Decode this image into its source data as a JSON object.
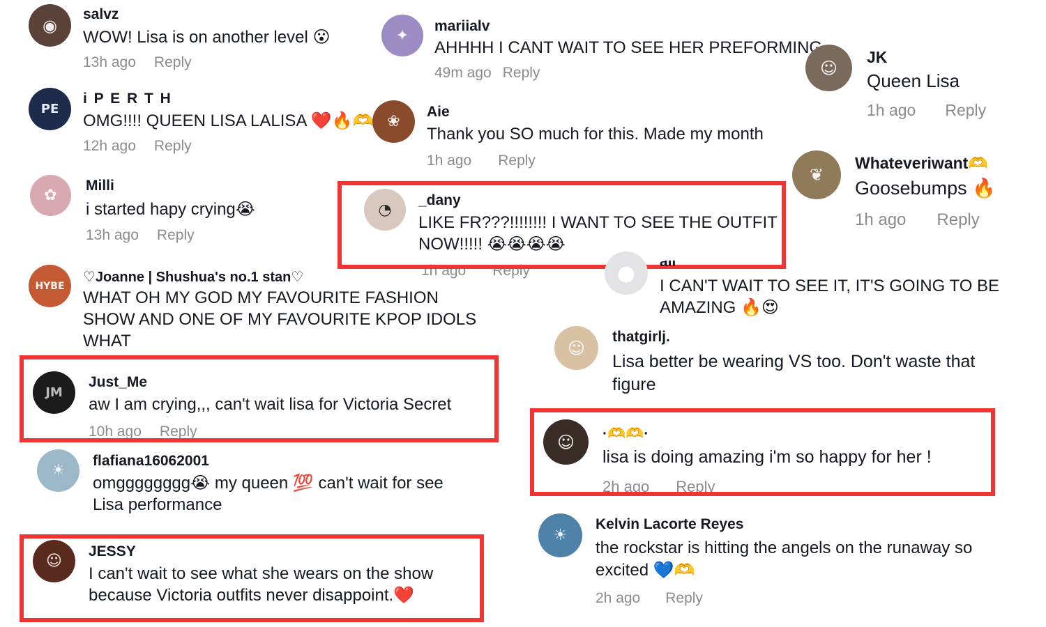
{
  "comments": {
    "salvz": {
      "user": "salvz",
      "text": "WOW! Lisa is on another level 😮",
      "time": "13h ago",
      "reply": "Reply",
      "avatar_color": "#5a4238"
    },
    "iperth": {
      "user": "i P E R T H",
      "text": "OMG!!!! QUEEN LISA LALISA ❤️🔥🫶",
      "time": "12h ago",
      "reply": "Reply",
      "avatar_color": "#1f2b4a"
    },
    "milli": {
      "user": "Milli",
      "text": "i started hapy crying😭",
      "time": "13h ago",
      "reply": "Reply",
      "avatar_color": "#d9a9b2"
    },
    "joanne": {
      "user": "♡Joanne | Shushua's no.1 stan♡",
      "text_lines": [
        "WHAT OH MY GOD MY FAVOURITE FASHION",
        "SHOW AND ONE OF MY FAVOURITE KPOP IDOLS",
        "WHAT"
      ],
      "avatar_color": "#c45a32"
    },
    "justme": {
      "user": "Just_Me",
      "text": "aw I am crying,,, can't wait lisa for Victoria Secret",
      "time": "10h ago",
      "reply": "Reply",
      "avatar_color": "#1b1b1b"
    },
    "flafiana": {
      "user": "flafiana16062001",
      "text_lines": [
        "omgggggggg😭 my queen 💯 can't wait for see",
        "Lisa performance"
      ],
      "avatar_color": "#9bb8c8"
    },
    "jessy": {
      "user": "JESSY",
      "text_lines": [
        "I can't wait to see what she wears on the show",
        "because Victoria outfits never disappoint.❤️"
      ],
      "avatar_color": "#5b2a1e"
    },
    "mariialv": {
      "user": "mariialv",
      "text": "AHHHH I CANT WAIT TO SEE HER PREFORMING",
      "time": "49m ago",
      "reply": "Reply",
      "avatar_color": "#9d8cc4"
    },
    "aie": {
      "user": "Aie",
      "text": "Thank you SO much for this. Made my month",
      "time": "1h ago",
      "reply": "Reply",
      "avatar_color": "#8a4a2c"
    },
    "dany": {
      "user": "_dany",
      "text_lines": [
        "LIKE FR???!!!!!!!! I WANT TO SEE THE OUTFIT",
        "NOW!!!!! 😭😭😭😭"
      ],
      "time": "1h ago",
      "reply": "Reply",
      "avatar_color": "#d8c8bd"
    },
    "jk": {
      "user": "JK",
      "text": "Queen Lisa",
      "time": "1h ago",
      "reply": "Reply",
      "avatar_color": "#7a6a5c"
    },
    "whatever": {
      "user": "Whateveriwant🫶",
      "text": "Goosebumps 🔥",
      "time": "1h ago",
      "reply": "Reply",
      "avatar_color": "#8f7a5a"
    },
    "ali": {
      "user": "ali",
      "text_lines": [
        "I CAN'T WAIT TO SEE IT, IT'S GOING TO BE",
        "AMAZING 🔥😍"
      ],
      "avatar_color": "#e3e3e6"
    },
    "thatgirlj": {
      "user": "thatgirlj.",
      "text_lines": [
        "Lisa better be wearing VS too. Don't waste that",
        "figure"
      ],
      "avatar_color": "#d9c2a4"
    },
    "dot": {
      "user": "·🫶🫶·",
      "text": "lisa is doing amazing i'm so happy for her !",
      "time": "2h ago",
      "reply": "Reply",
      "avatar_color": "#3a2c26"
    },
    "kelvin": {
      "user": "Kelvin Lacorte Reyes",
      "text_lines": [
        "the rockstar is hitting the angels on the runaway so",
        "excited 💙🫶"
      ],
      "time": "2h ago",
      "reply": "Reply",
      "avatar_color": "#4f82a8"
    }
  },
  "highlight_color": "#ef3434"
}
